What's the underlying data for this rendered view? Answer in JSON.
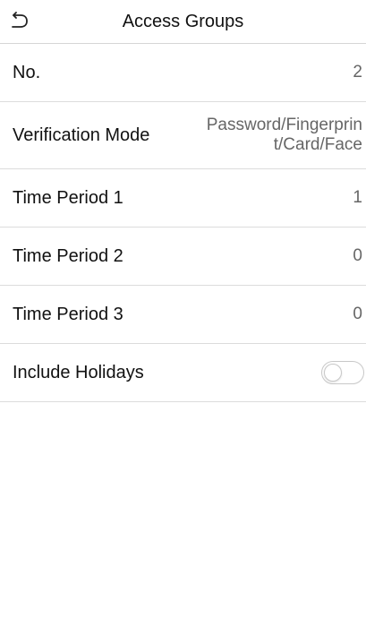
{
  "header": {
    "title": "Access Groups",
    "back_icon": "undo-arrow-icon"
  },
  "rows": [
    {
      "label": "No.",
      "value": "2"
    },
    {
      "label": "Verification Mode",
      "value": "Password/Fingerprint/Card/Face"
    },
    {
      "label": "Time Period 1",
      "value": "1"
    },
    {
      "label": "Time Period 2",
      "value": "0"
    },
    {
      "label": "Time Period 3",
      "value": "0"
    },
    {
      "label": "Include Holidays",
      "toggle": "off"
    }
  ],
  "colors": {
    "text": "#111111",
    "value": "#666666",
    "divider": "#dcdcdc"
  }
}
